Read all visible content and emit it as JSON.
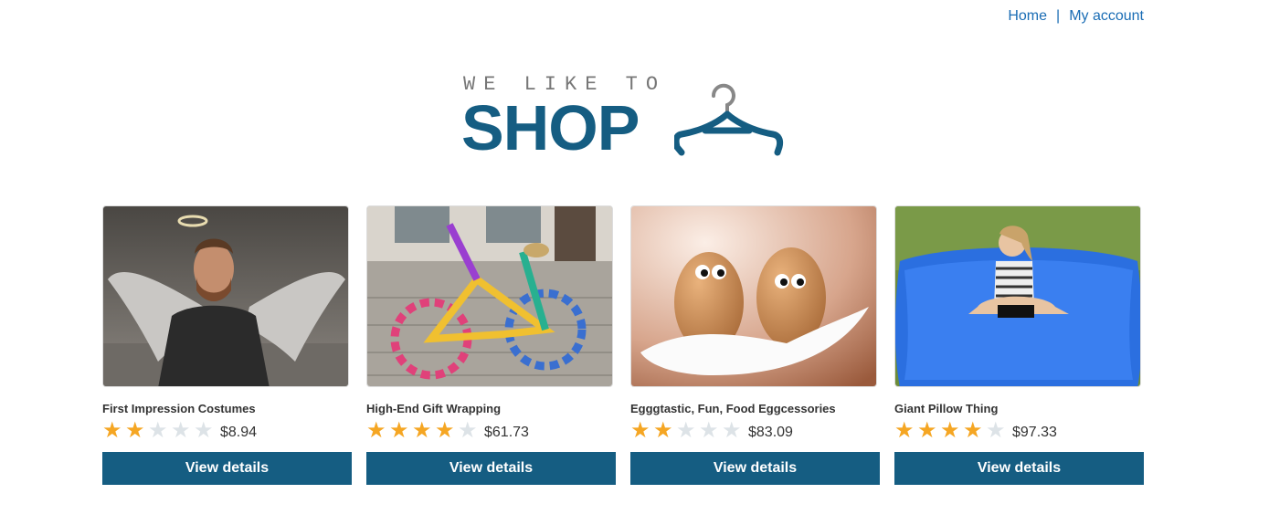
{
  "nav": {
    "home": "Home",
    "separator": "|",
    "account": "My account"
  },
  "logo": {
    "tagline": "WE LIKE TO",
    "word": "SHOP"
  },
  "colors": {
    "brand": "#155d82",
    "link": "#1a6db5",
    "star_on": "#f5a623",
    "star_off": "#dde3e7"
  },
  "products": [
    {
      "name": "First Impression Costumes",
      "rating": 2,
      "price": "$8.94",
      "button": "View details",
      "image_icon": "angel-costume-image"
    },
    {
      "name": "High-End Gift Wrapping",
      "rating": 4,
      "price": "$61.73",
      "button": "View details",
      "image_icon": "knitted-bicycle-image"
    },
    {
      "name": "Egggtastic, Fun, Food Eggcessories",
      "rating": 2,
      "price": "$83.09",
      "button": "View details",
      "image_icon": "eggs-with-eyes-image"
    },
    {
      "name": "Giant Pillow Thing",
      "rating": 4,
      "price": "$97.33",
      "button": "View details",
      "image_icon": "giant-pillow-image"
    }
  ]
}
